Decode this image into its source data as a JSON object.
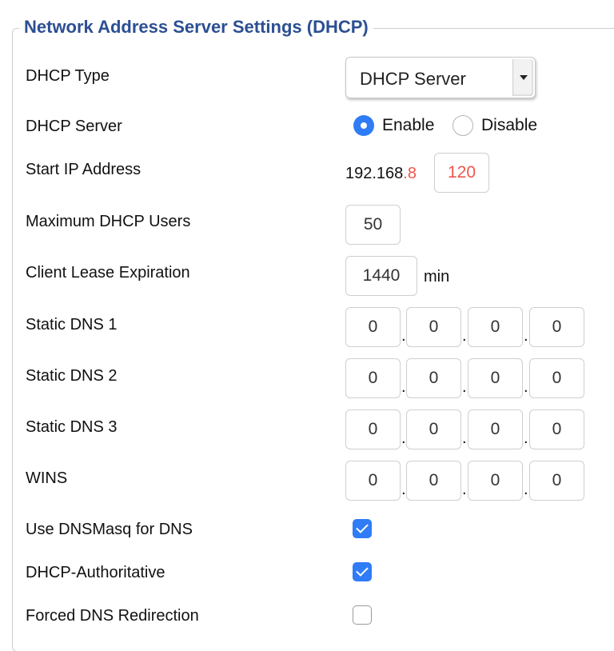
{
  "section": {
    "legend": "Network Address Server Settings (DHCP)"
  },
  "dhcp_type": {
    "label": "DHCP Type",
    "selected": "DHCP Server"
  },
  "dhcp_server": {
    "label": "DHCP Server",
    "enable_label": "Enable",
    "disable_label": "Disable",
    "value": "Enable"
  },
  "start_ip": {
    "label": "Start IP Address",
    "prefix": "192.168",
    "third_octet": ".8",
    "last_octet": "120"
  },
  "max_users": {
    "label": "Maximum DHCP Users",
    "value": "50"
  },
  "lease": {
    "label": "Client Lease Expiration",
    "value": "1440",
    "unit": "min"
  },
  "dns1": {
    "label": "Static DNS 1",
    "octets": [
      "0",
      "0",
      "0",
      "0"
    ]
  },
  "dns2": {
    "label": "Static DNS 2",
    "octets": [
      "0",
      "0",
      "0",
      "0"
    ]
  },
  "dns3": {
    "label": "Static DNS 3",
    "octets": [
      "0",
      "0",
      "0",
      "0"
    ]
  },
  "wins": {
    "label": "WINS",
    "octets": [
      "0",
      "0",
      "0",
      "0"
    ]
  },
  "separator": ".",
  "dnsmasq": {
    "label": "Use DNSMasq for DNS",
    "checked": true
  },
  "authoritative": {
    "label": "DHCP-Authoritative",
    "checked": true
  },
  "forced_dns": {
    "label": "Forced DNS Redirection",
    "checked": false
  },
  "colors": {
    "accent": "#2f7cf6",
    "legend": "#2c4f93",
    "ip_red": "#f0564b"
  }
}
